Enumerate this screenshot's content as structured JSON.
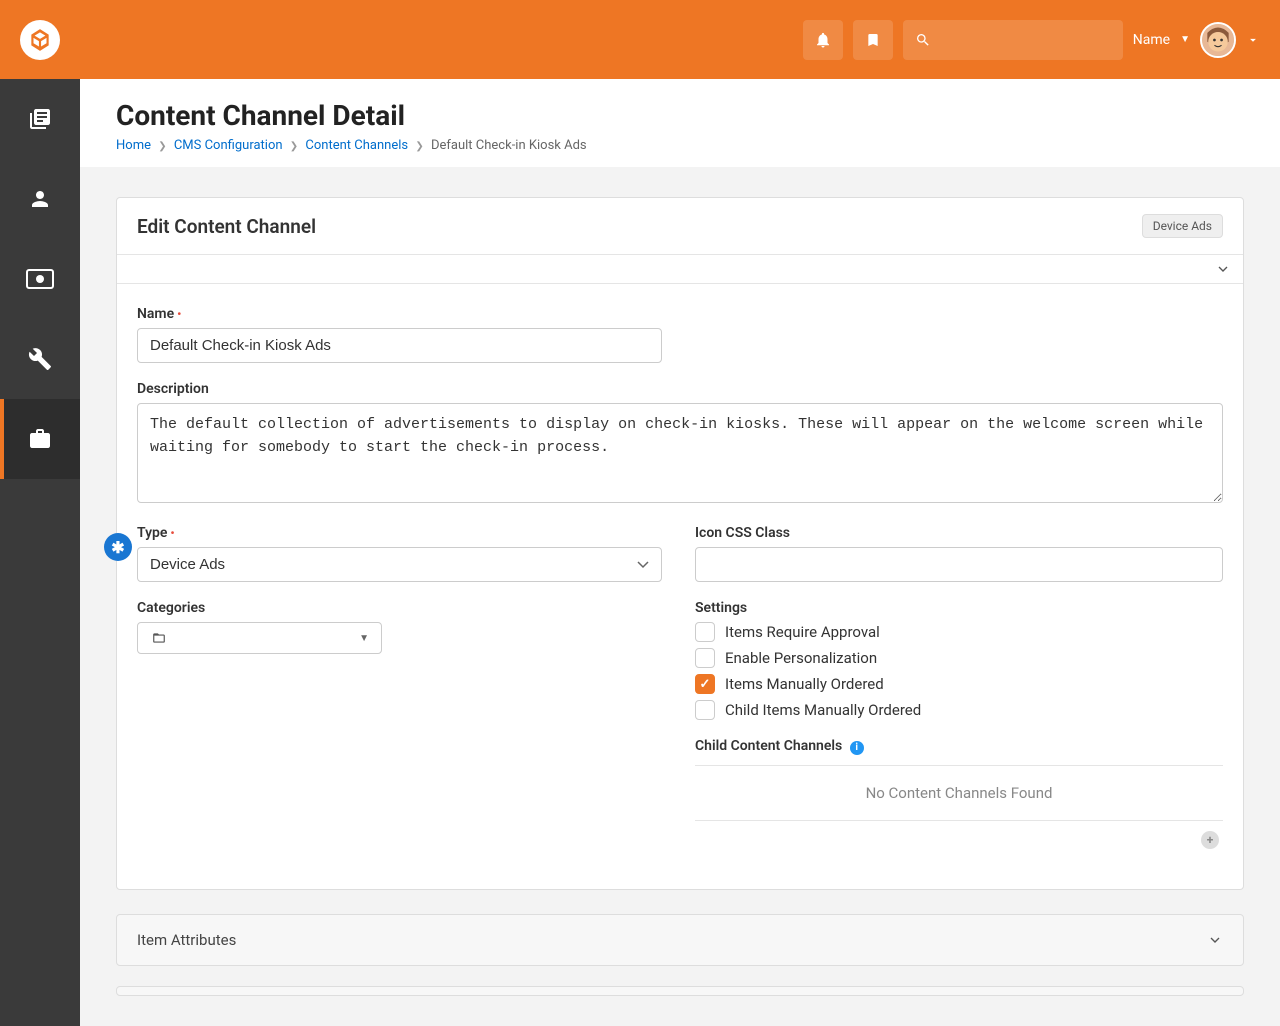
{
  "header": {
    "user_label": "Name"
  },
  "page": {
    "title": "Content Channel Detail",
    "breadcrumbs": [
      "Home",
      "CMS Configuration",
      "Content Channels",
      "Default Check-in Kiosk Ads"
    ]
  },
  "panel": {
    "title": "Edit Content Channel",
    "badge": "Device Ads"
  },
  "form": {
    "name_label": "Name",
    "name_value": "Default Check-in Kiosk Ads",
    "desc_label": "Description",
    "desc_value": "The default collection of advertisements to display on check-in kiosks. These will appear on the welcome screen while waiting for somebody to start the check-in process.",
    "type_label": "Type",
    "type_value": "Device Ads",
    "categories_label": "Categories",
    "icon_css_label": "Icon CSS Class",
    "icon_css_value": "",
    "settings_label": "Settings",
    "settings": {
      "approval": "Items Require Approval",
      "personalization": "Enable Personalization",
      "manual_order": "Items Manually Ordered",
      "child_manual": "Child Items Manually Ordered"
    },
    "child_channels_label": "Child Content Channels",
    "child_channels_empty": "No Content Channels Found"
  },
  "sections": {
    "item_attributes": "Item Attributes"
  }
}
